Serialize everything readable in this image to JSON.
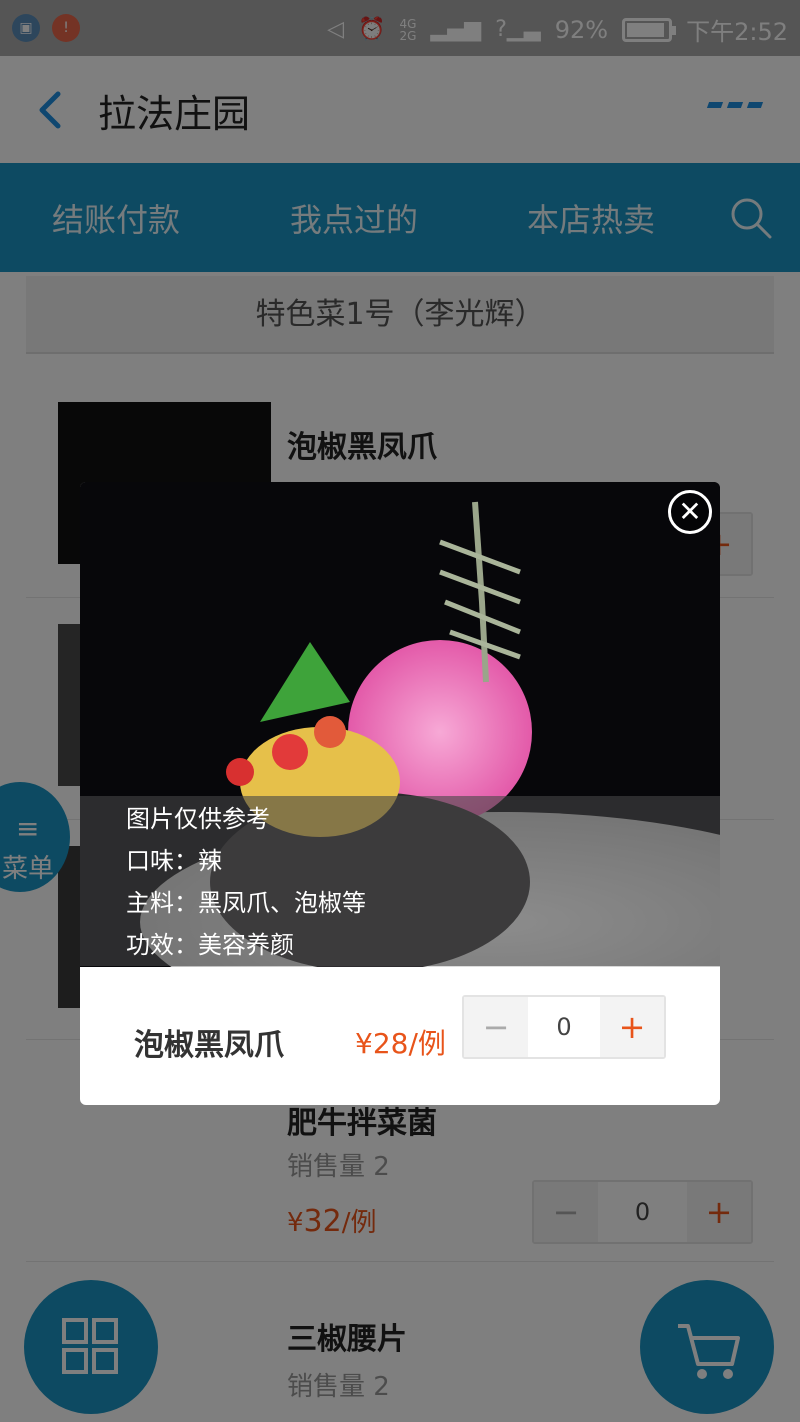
{
  "status_bar": {
    "battery_level": "92%",
    "battery_fraction": 0.92,
    "time": "下午2:52",
    "network_top": "4G",
    "network_bottom": "2G",
    "icons": [
      "gallery-icon",
      "notification-icon",
      "mute-icon",
      "alarm-icon",
      "signal-icon",
      "wifi-unknown-icon",
      "battery-icon"
    ]
  },
  "header": {
    "title": "拉法庄园",
    "back_icon": "back-arrow-icon",
    "more_icon": "more-icon"
  },
  "tabs": {
    "items": [
      {
        "label": "结账付款"
      },
      {
        "label": "我点过的"
      },
      {
        "label": "本店热卖"
      }
    ],
    "search_icon": "search-icon"
  },
  "category": {
    "title": "特色菜1号（李光辉）"
  },
  "dishes": [
    {
      "name": "泡椒黑凤爪",
      "quantity": "0"
    },
    {
      "name": "肥牛拌菜菌",
      "sales": "销售量 2",
      "price_symbol": "¥",
      "price_value": "32",
      "price_unit": "/例",
      "quantity": "0"
    },
    {
      "name": "三椒腰片",
      "sales": "销售量 2"
    }
  ],
  "side_menu": {
    "label": "菜单",
    "lines_icon": "≡"
  },
  "fabs": {
    "grid_icon": "grid-icon",
    "cart_icon": "cart-icon"
  },
  "modal": {
    "caption": {
      "line1": "图片仅供参考",
      "line2": "口味：辣",
      "line3": "主料：黑凤爪、泡椒等",
      "line4": "功效：美容养颜"
    },
    "dish_name": "泡椒黑凤爪",
    "price": "¥28/例",
    "minus": "−",
    "quantity": "0",
    "plus": "+",
    "close_icon": "close-icon"
  },
  "colors": {
    "accent": "#1a95c4",
    "price": "#e8541a",
    "link": "#1e8fe1"
  }
}
